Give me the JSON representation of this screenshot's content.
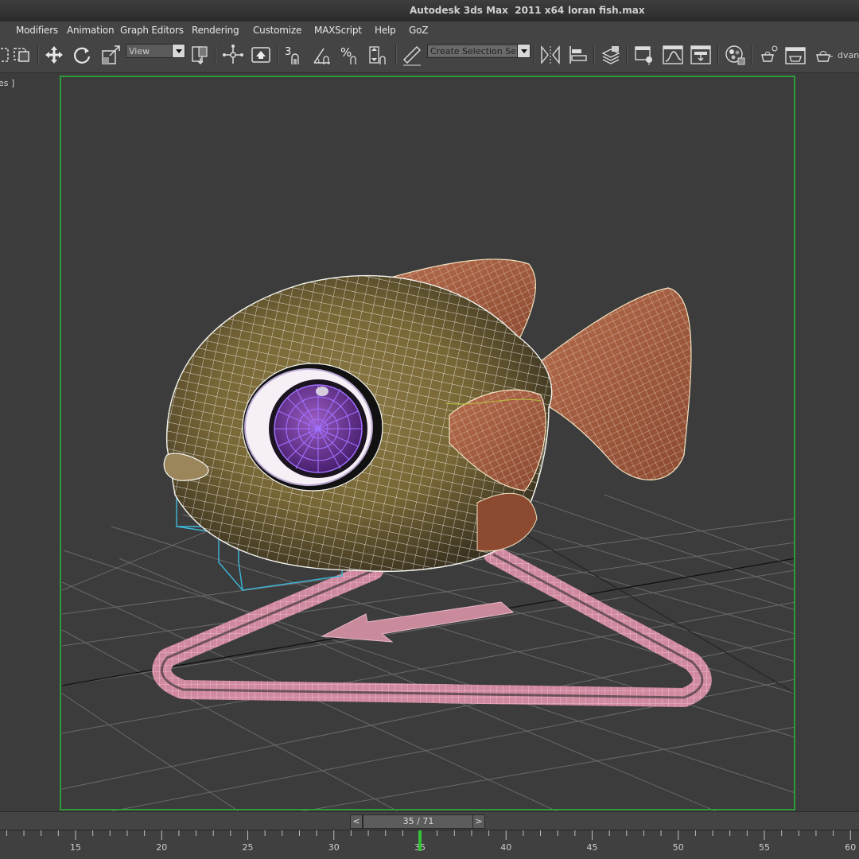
{
  "window": {
    "app_title": "Autodesk 3ds Max  2011 x64",
    "file_name": "loran fish.max"
  },
  "menu": {
    "items": [
      "Modifiers",
      "Animation",
      "Graph Editors",
      "Rendering",
      "Customize",
      "MAXScript",
      "Help",
      "GoZ"
    ]
  },
  "toolbar": {
    "reference_coord_value": "View",
    "selection_set_placeholder": "Create Selection Se",
    "snap_angle_label": "3",
    "percent_snap_label": "%",
    "truncated_right_label": "dvan"
  },
  "viewport": {
    "label": "es ]",
    "active_border_color": "#2d9a3b"
  },
  "timeline": {
    "prev_label": "<",
    "next_label": ">",
    "frame_display": "35 / 71",
    "current_frame": 35,
    "total_frames": 71,
    "tick_labels": [
      "15",
      "20",
      "25",
      "30",
      "35",
      "40",
      "45",
      "50",
      "55",
      "60"
    ],
    "current_marker_color": "#33cc33"
  }
}
